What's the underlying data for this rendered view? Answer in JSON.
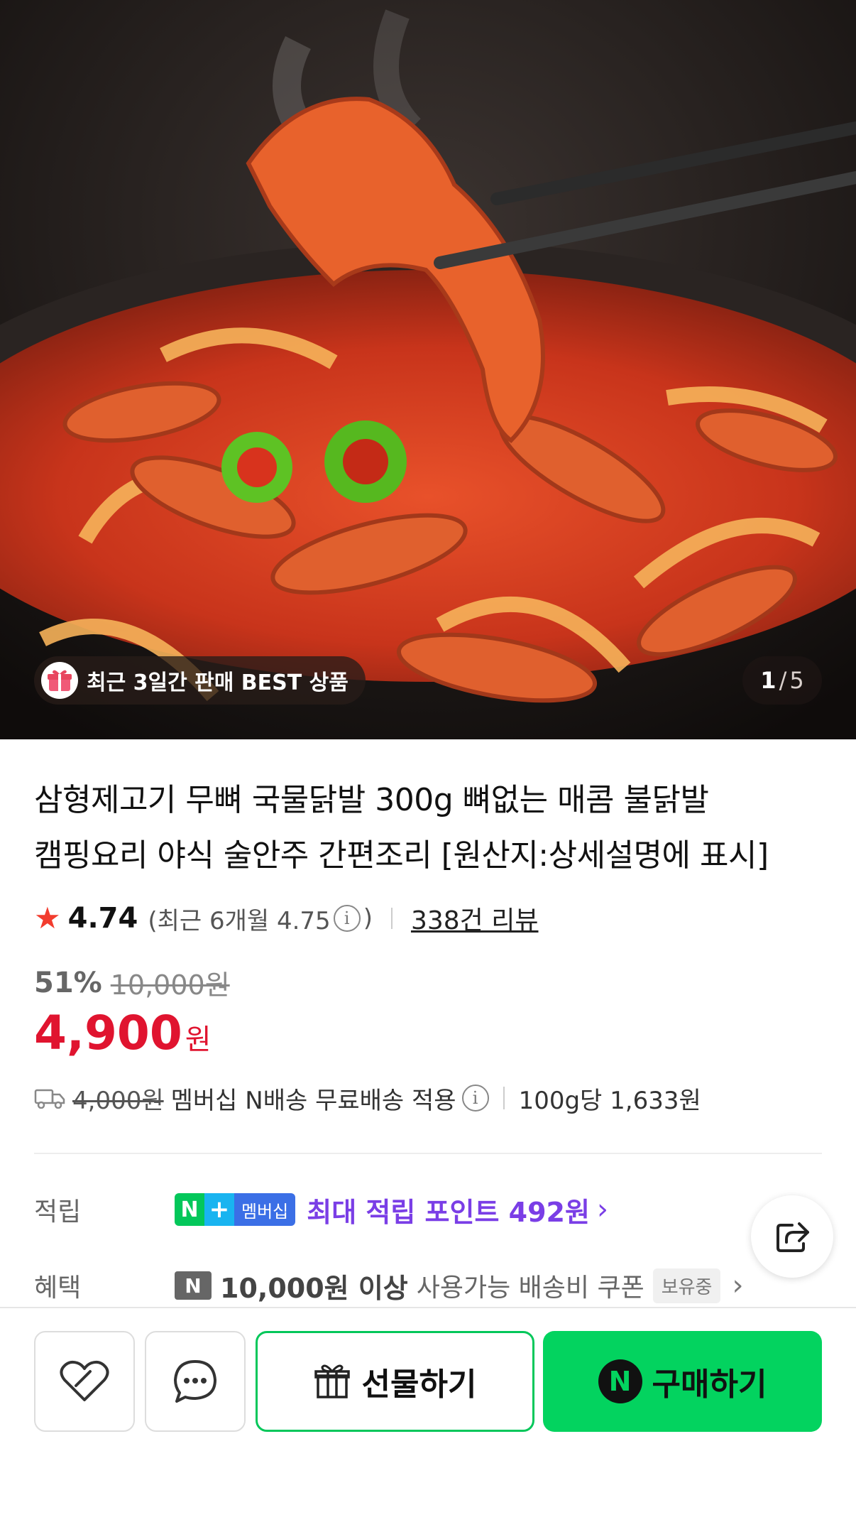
{
  "hero": {
    "badge_text": "최근 3일간 판매 BEST 상품",
    "page_current": "1",
    "page_separator": "/",
    "page_total": "5"
  },
  "product": {
    "title_line1": "삼형제고기 무뼈 국물닭발 300g 뼈없는 매콤 불닭발",
    "title_line2": "캠핑요리 야식 술안주 간편조리 [원산지:상세설명에 표시]",
    "rating": "4.74",
    "recent_rating_open": "(최근 6개월 4.75",
    "recent_rating_close": ")",
    "review_count": "338건 리뷰",
    "discount_pct": "51%",
    "original_price": "10,000원",
    "price_number": "4,900",
    "price_unit": "원",
    "shipping_fee": "4,000원",
    "shipping_text": "멤버십 N배송 무료배송 적용",
    "unit_price": "100g당 1,633원"
  },
  "benefits": {
    "points_label": "적립",
    "membership_badge_n": "N",
    "membership_badge_plus": "+",
    "membership_badge_text": "멤버십",
    "points_text": "최대 적립 포인트 492원",
    "perk_label": "혜택",
    "coupon_badge": "N",
    "coupon_strong": "10,000원 이상",
    "coupon_rest": "사용가능 배송비 쿠폰",
    "coupon_owned": "보유중"
  },
  "actions": {
    "gift_label": "선물하기",
    "buy_badge": "N",
    "buy_label": "구매하기"
  },
  "colors": {
    "price_red": "#e0142f",
    "naver_green": "#03c75a",
    "points_purple": "#7a3ee6",
    "star_red": "#f23c2e"
  }
}
